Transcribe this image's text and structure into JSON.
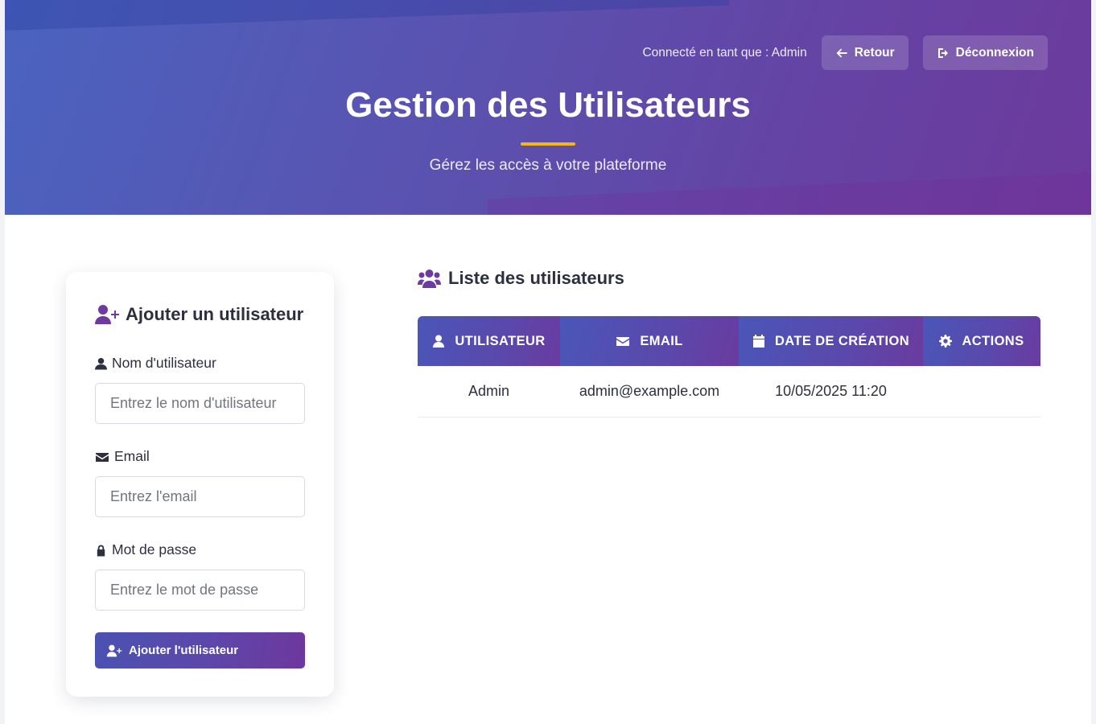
{
  "header": {
    "logged_in_text": "Connecté en tant que : Admin",
    "back_label": "Retour",
    "logout_label": "Déconnexion",
    "title": "Gestion des Utilisateurs",
    "subtitle": "Gérez les accès à votre plateforme"
  },
  "add_form": {
    "title": "Ajouter un utilisateur",
    "username_label": "Nom d'utilisateur",
    "username_placeholder": "Entrez le nom d'utilisateur",
    "email_label": "Email",
    "email_placeholder": "Entrez l'email",
    "password_label": "Mot de passe",
    "password_placeholder": "Entrez le mot de passe",
    "submit_label": "Ajouter l'utilisateur"
  },
  "user_list": {
    "title": "Liste des utilisateurs",
    "columns": [
      "UTILISATEUR",
      "EMAIL",
      "DATE DE CRÉATION",
      "ACTIONS"
    ],
    "rows": [
      {
        "username": "Admin",
        "email": "admin@example.com",
        "created": "10/05/2025 11:20",
        "actions": ""
      }
    ]
  },
  "colors": {
    "accent_underline": "#f5b70d",
    "gradient_start": "#4a63bf",
    "gradient_end": "#6c3a9c",
    "icon_purple": "#6e3aa0"
  },
  "icons": {
    "back": "arrow-left-icon",
    "logout": "sign-out-icon",
    "add_user": "user-plus-icon",
    "user": "user-icon",
    "email": "envelope-icon",
    "password": "lock-icon",
    "users": "users-icon",
    "date": "calendar-icon",
    "actions": "gear-icon"
  }
}
